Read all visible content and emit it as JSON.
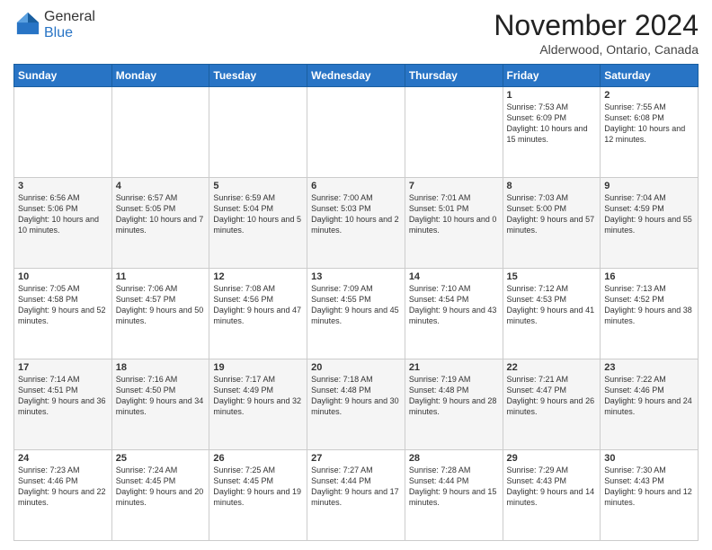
{
  "header": {
    "logo_general": "General",
    "logo_blue": "Blue",
    "month_title": "November 2024",
    "location": "Alderwood, Ontario, Canada"
  },
  "days_of_week": [
    "Sunday",
    "Monday",
    "Tuesday",
    "Wednesday",
    "Thursday",
    "Friday",
    "Saturday"
  ],
  "weeks": [
    [
      {
        "day": "",
        "info": ""
      },
      {
        "day": "",
        "info": ""
      },
      {
        "day": "",
        "info": ""
      },
      {
        "day": "",
        "info": ""
      },
      {
        "day": "",
        "info": ""
      },
      {
        "day": "1",
        "info": "Sunrise: 7:53 AM\nSunset: 6:09 PM\nDaylight: 10 hours and 15 minutes."
      },
      {
        "day": "2",
        "info": "Sunrise: 7:55 AM\nSunset: 6:08 PM\nDaylight: 10 hours and 12 minutes."
      }
    ],
    [
      {
        "day": "3",
        "info": "Sunrise: 6:56 AM\nSunset: 5:06 PM\nDaylight: 10 hours and 10 minutes."
      },
      {
        "day": "4",
        "info": "Sunrise: 6:57 AM\nSunset: 5:05 PM\nDaylight: 10 hours and 7 minutes."
      },
      {
        "day": "5",
        "info": "Sunrise: 6:59 AM\nSunset: 5:04 PM\nDaylight: 10 hours and 5 minutes."
      },
      {
        "day": "6",
        "info": "Sunrise: 7:00 AM\nSunset: 5:03 PM\nDaylight: 10 hours and 2 minutes."
      },
      {
        "day": "7",
        "info": "Sunrise: 7:01 AM\nSunset: 5:01 PM\nDaylight: 10 hours and 0 minutes."
      },
      {
        "day": "8",
        "info": "Sunrise: 7:03 AM\nSunset: 5:00 PM\nDaylight: 9 hours and 57 minutes."
      },
      {
        "day": "9",
        "info": "Sunrise: 7:04 AM\nSunset: 4:59 PM\nDaylight: 9 hours and 55 minutes."
      }
    ],
    [
      {
        "day": "10",
        "info": "Sunrise: 7:05 AM\nSunset: 4:58 PM\nDaylight: 9 hours and 52 minutes."
      },
      {
        "day": "11",
        "info": "Sunrise: 7:06 AM\nSunset: 4:57 PM\nDaylight: 9 hours and 50 minutes."
      },
      {
        "day": "12",
        "info": "Sunrise: 7:08 AM\nSunset: 4:56 PM\nDaylight: 9 hours and 47 minutes."
      },
      {
        "day": "13",
        "info": "Sunrise: 7:09 AM\nSunset: 4:55 PM\nDaylight: 9 hours and 45 minutes."
      },
      {
        "day": "14",
        "info": "Sunrise: 7:10 AM\nSunset: 4:54 PM\nDaylight: 9 hours and 43 minutes."
      },
      {
        "day": "15",
        "info": "Sunrise: 7:12 AM\nSunset: 4:53 PM\nDaylight: 9 hours and 41 minutes."
      },
      {
        "day": "16",
        "info": "Sunrise: 7:13 AM\nSunset: 4:52 PM\nDaylight: 9 hours and 38 minutes."
      }
    ],
    [
      {
        "day": "17",
        "info": "Sunrise: 7:14 AM\nSunset: 4:51 PM\nDaylight: 9 hours and 36 minutes."
      },
      {
        "day": "18",
        "info": "Sunrise: 7:16 AM\nSunset: 4:50 PM\nDaylight: 9 hours and 34 minutes."
      },
      {
        "day": "19",
        "info": "Sunrise: 7:17 AM\nSunset: 4:49 PM\nDaylight: 9 hours and 32 minutes."
      },
      {
        "day": "20",
        "info": "Sunrise: 7:18 AM\nSunset: 4:48 PM\nDaylight: 9 hours and 30 minutes."
      },
      {
        "day": "21",
        "info": "Sunrise: 7:19 AM\nSunset: 4:48 PM\nDaylight: 9 hours and 28 minutes."
      },
      {
        "day": "22",
        "info": "Sunrise: 7:21 AM\nSunset: 4:47 PM\nDaylight: 9 hours and 26 minutes."
      },
      {
        "day": "23",
        "info": "Sunrise: 7:22 AM\nSunset: 4:46 PM\nDaylight: 9 hours and 24 minutes."
      }
    ],
    [
      {
        "day": "24",
        "info": "Sunrise: 7:23 AM\nSunset: 4:46 PM\nDaylight: 9 hours and 22 minutes."
      },
      {
        "day": "25",
        "info": "Sunrise: 7:24 AM\nSunset: 4:45 PM\nDaylight: 9 hours and 20 minutes."
      },
      {
        "day": "26",
        "info": "Sunrise: 7:25 AM\nSunset: 4:45 PM\nDaylight: 9 hours and 19 minutes."
      },
      {
        "day": "27",
        "info": "Sunrise: 7:27 AM\nSunset: 4:44 PM\nDaylight: 9 hours and 17 minutes."
      },
      {
        "day": "28",
        "info": "Sunrise: 7:28 AM\nSunset: 4:44 PM\nDaylight: 9 hours and 15 minutes."
      },
      {
        "day": "29",
        "info": "Sunrise: 7:29 AM\nSunset: 4:43 PM\nDaylight: 9 hours and 14 minutes."
      },
      {
        "day": "30",
        "info": "Sunrise: 7:30 AM\nSunset: 4:43 PM\nDaylight: 9 hours and 12 minutes."
      }
    ]
  ]
}
